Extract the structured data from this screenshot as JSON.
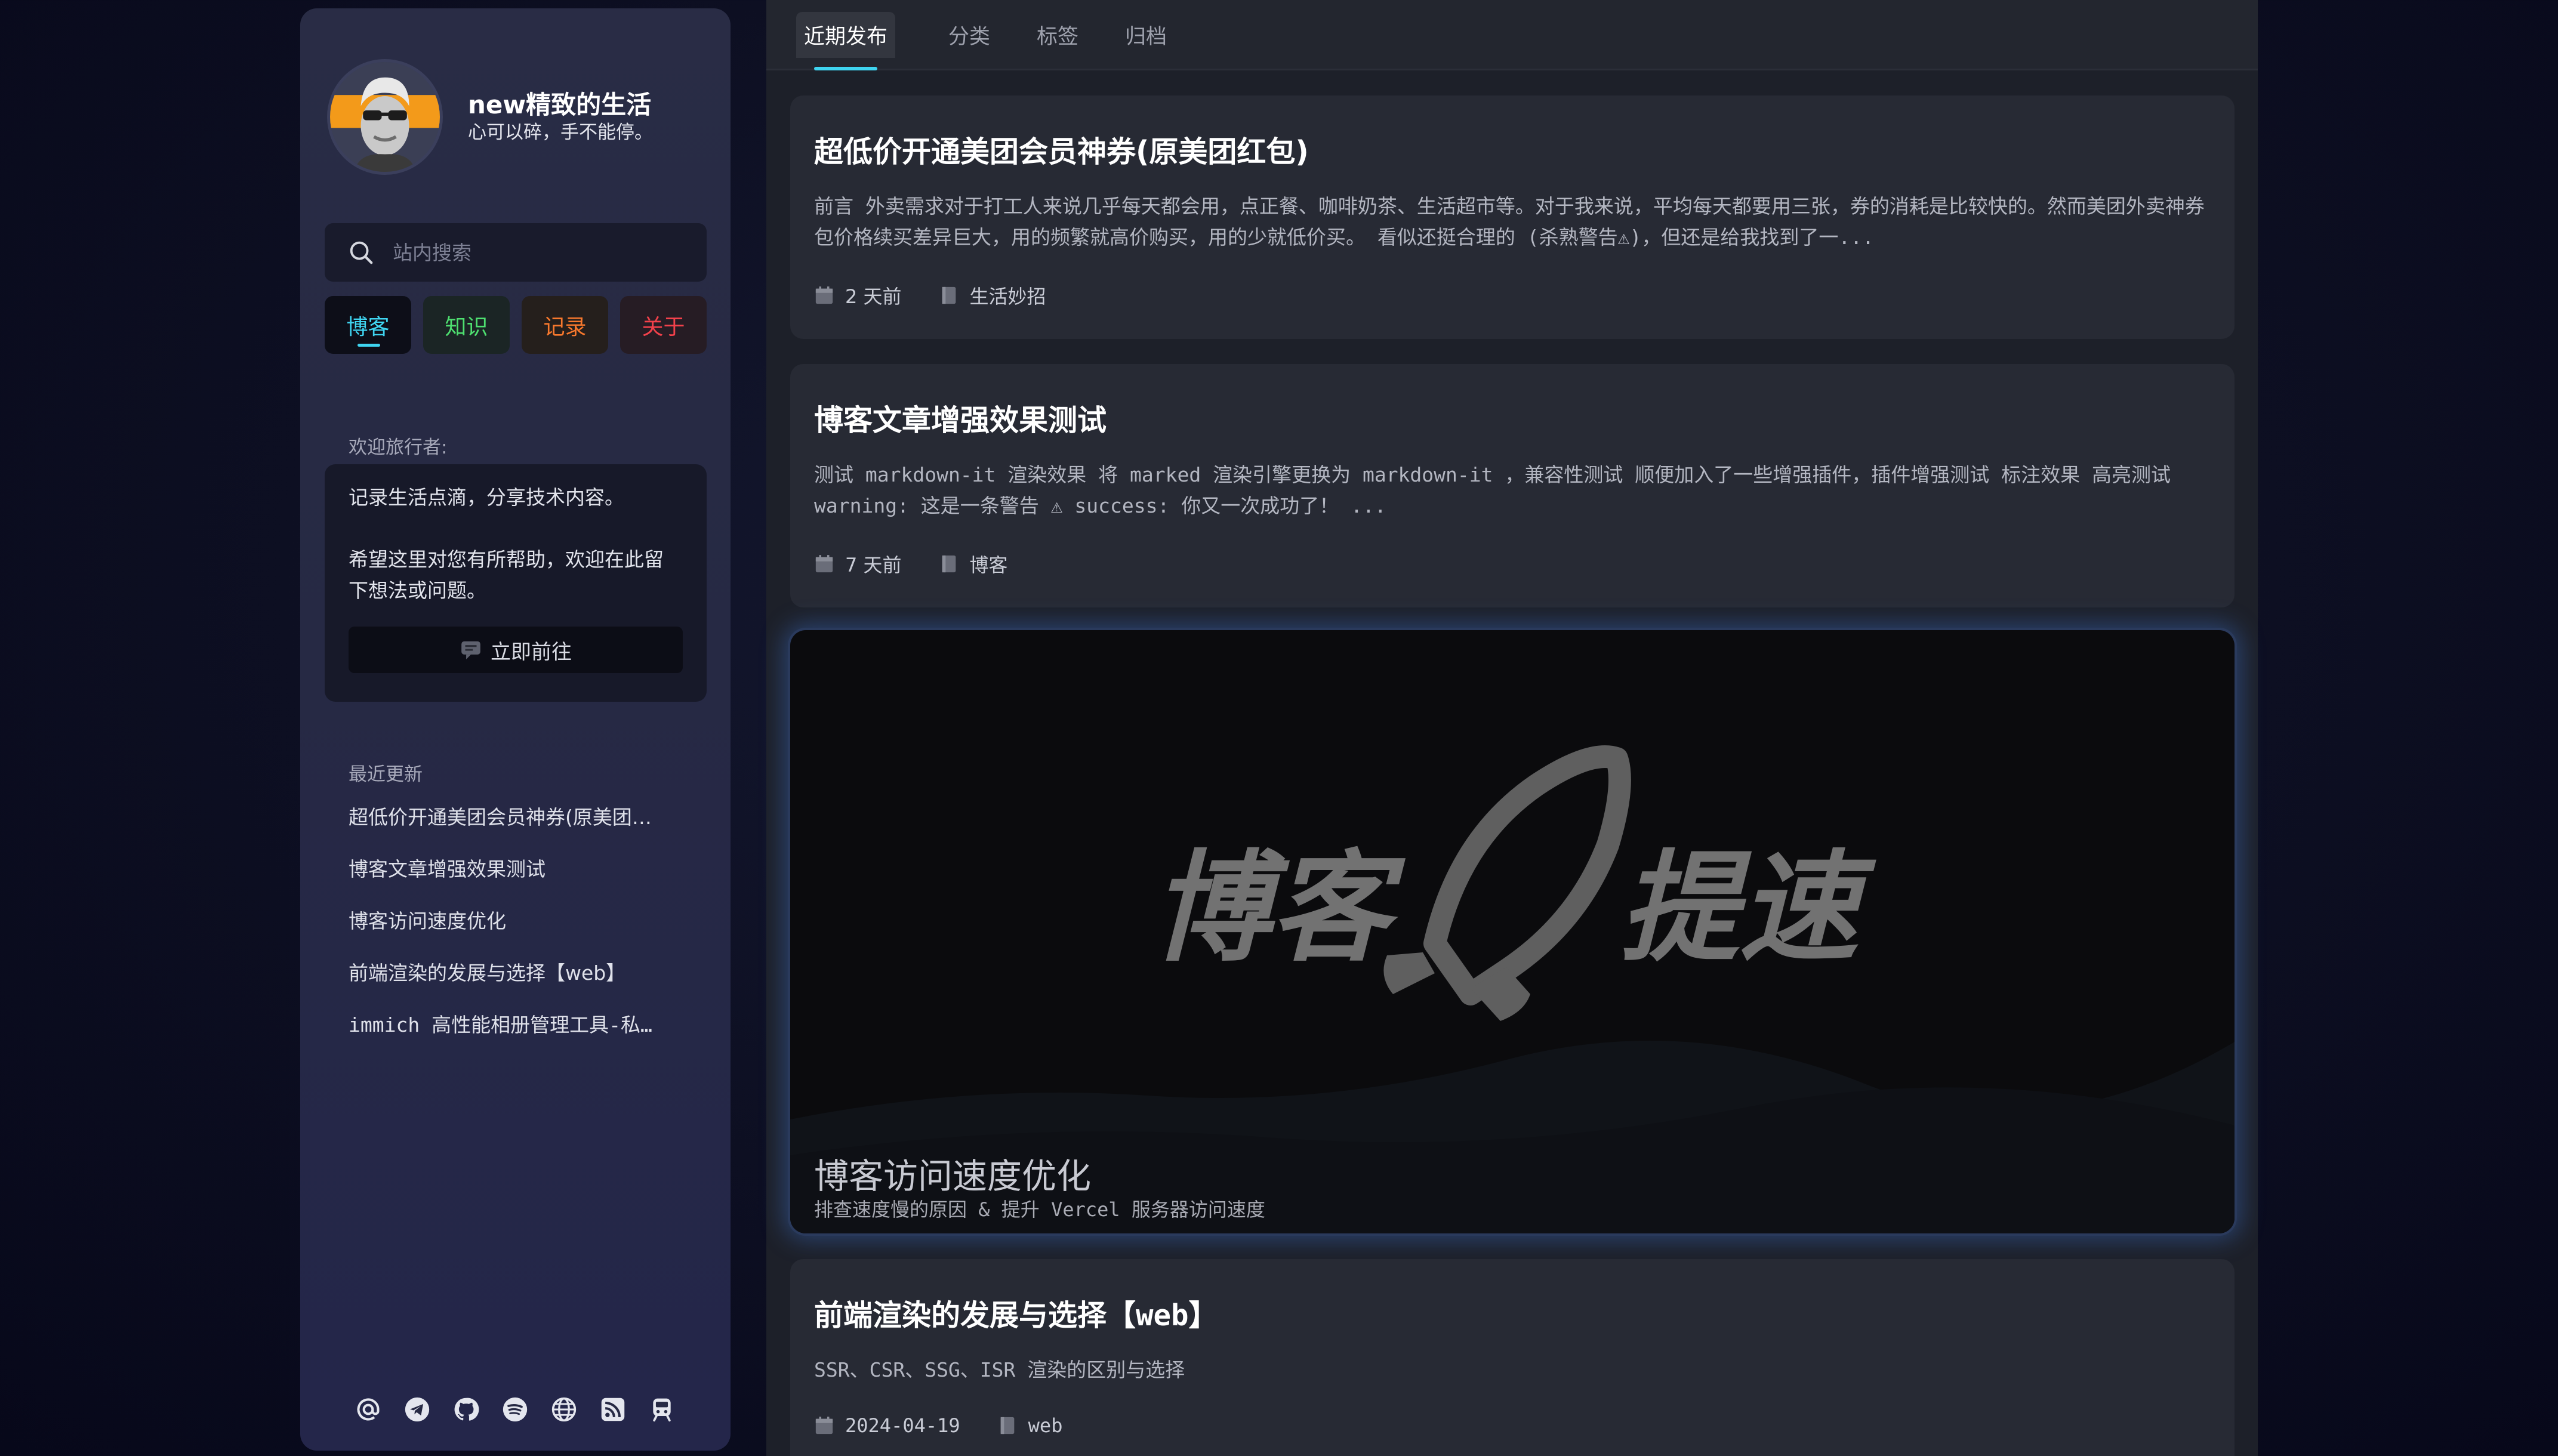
{
  "profile": {
    "name": "new精致的生活",
    "motto": "心可以碎，手不能停。"
  },
  "search": {
    "placeholder": "站内搜索"
  },
  "nav": [
    {
      "label": "博客",
      "color": "#3fd4f0",
      "active": true
    },
    {
      "label": "知识",
      "color": "#4ee070"
    },
    {
      "label": "记录",
      "color": "#f7782d"
    },
    {
      "label": "关于",
      "color": "#f2414b"
    }
  ],
  "welcome": {
    "heading": "欢迎旅行者:",
    "line1": "记录生活点滴，分享技术内容。",
    "line2": "希望这里对您有所帮助，欢迎在此留下想法或问题。",
    "button": "立即前往"
  },
  "recent": {
    "heading": "最近更新",
    "items": [
      "超低价开通美团会员神券(原美团…",
      "博客文章增强效果测试",
      "博客访问速度优化",
      "前端渲染的发展与选择【web】",
      "immich 高性能相册管理工具-私…"
    ]
  },
  "socials": [
    "at-icon",
    "telegram-icon",
    "github-icon",
    "spotify-icon",
    "globe-icon",
    "rss-icon",
    "train-icon"
  ],
  "tabs": [
    "近期发布",
    "分类",
    "标签",
    "归档"
  ],
  "posts": [
    {
      "title": "超低价开通美团会员神券(原美团红包)",
      "excerpt": "前言 外卖需求对于打工人来说几乎每天都会用，点正餐、咖啡奶茶、生活超市等。对于我来说，平均每天都要用三张，券的消耗是比较快的。然而美团外卖神券包价格续买差异巨大，用的频繁就高价购买，用的少就低价买。 看似还挺合理的 (杀熟警告⚠)，但还是给我找到了一...",
      "date": "2 天前",
      "category": "生活妙招"
    },
    {
      "title": "博客文章增强效果测试",
      "excerpt": "测试 markdown-it 渲染效果 将 marked 渲染引擎更换为 markdown-it ，兼容性测试 顺便加入了一些增强插件，插件增强测试 标注效果 高亮测试 warning: 这是一条警告 ⚠ success: 你又一次成功了！ ...",
      "date": "7 天前",
      "category": "博客"
    },
    {
      "title": "前端渲染的发展与选择【web】",
      "excerpt": "SSR、CSR、SSG、ISR 渲染的区别与选择",
      "date": "2024-04-19",
      "category": "web"
    }
  ],
  "feature": {
    "banner_left": "博客",
    "banner_right": "提速",
    "title": "博客访问速度优化",
    "subtitle": "排查速度慢的原因 & 提升 Vercel 服务器访问速度"
  }
}
